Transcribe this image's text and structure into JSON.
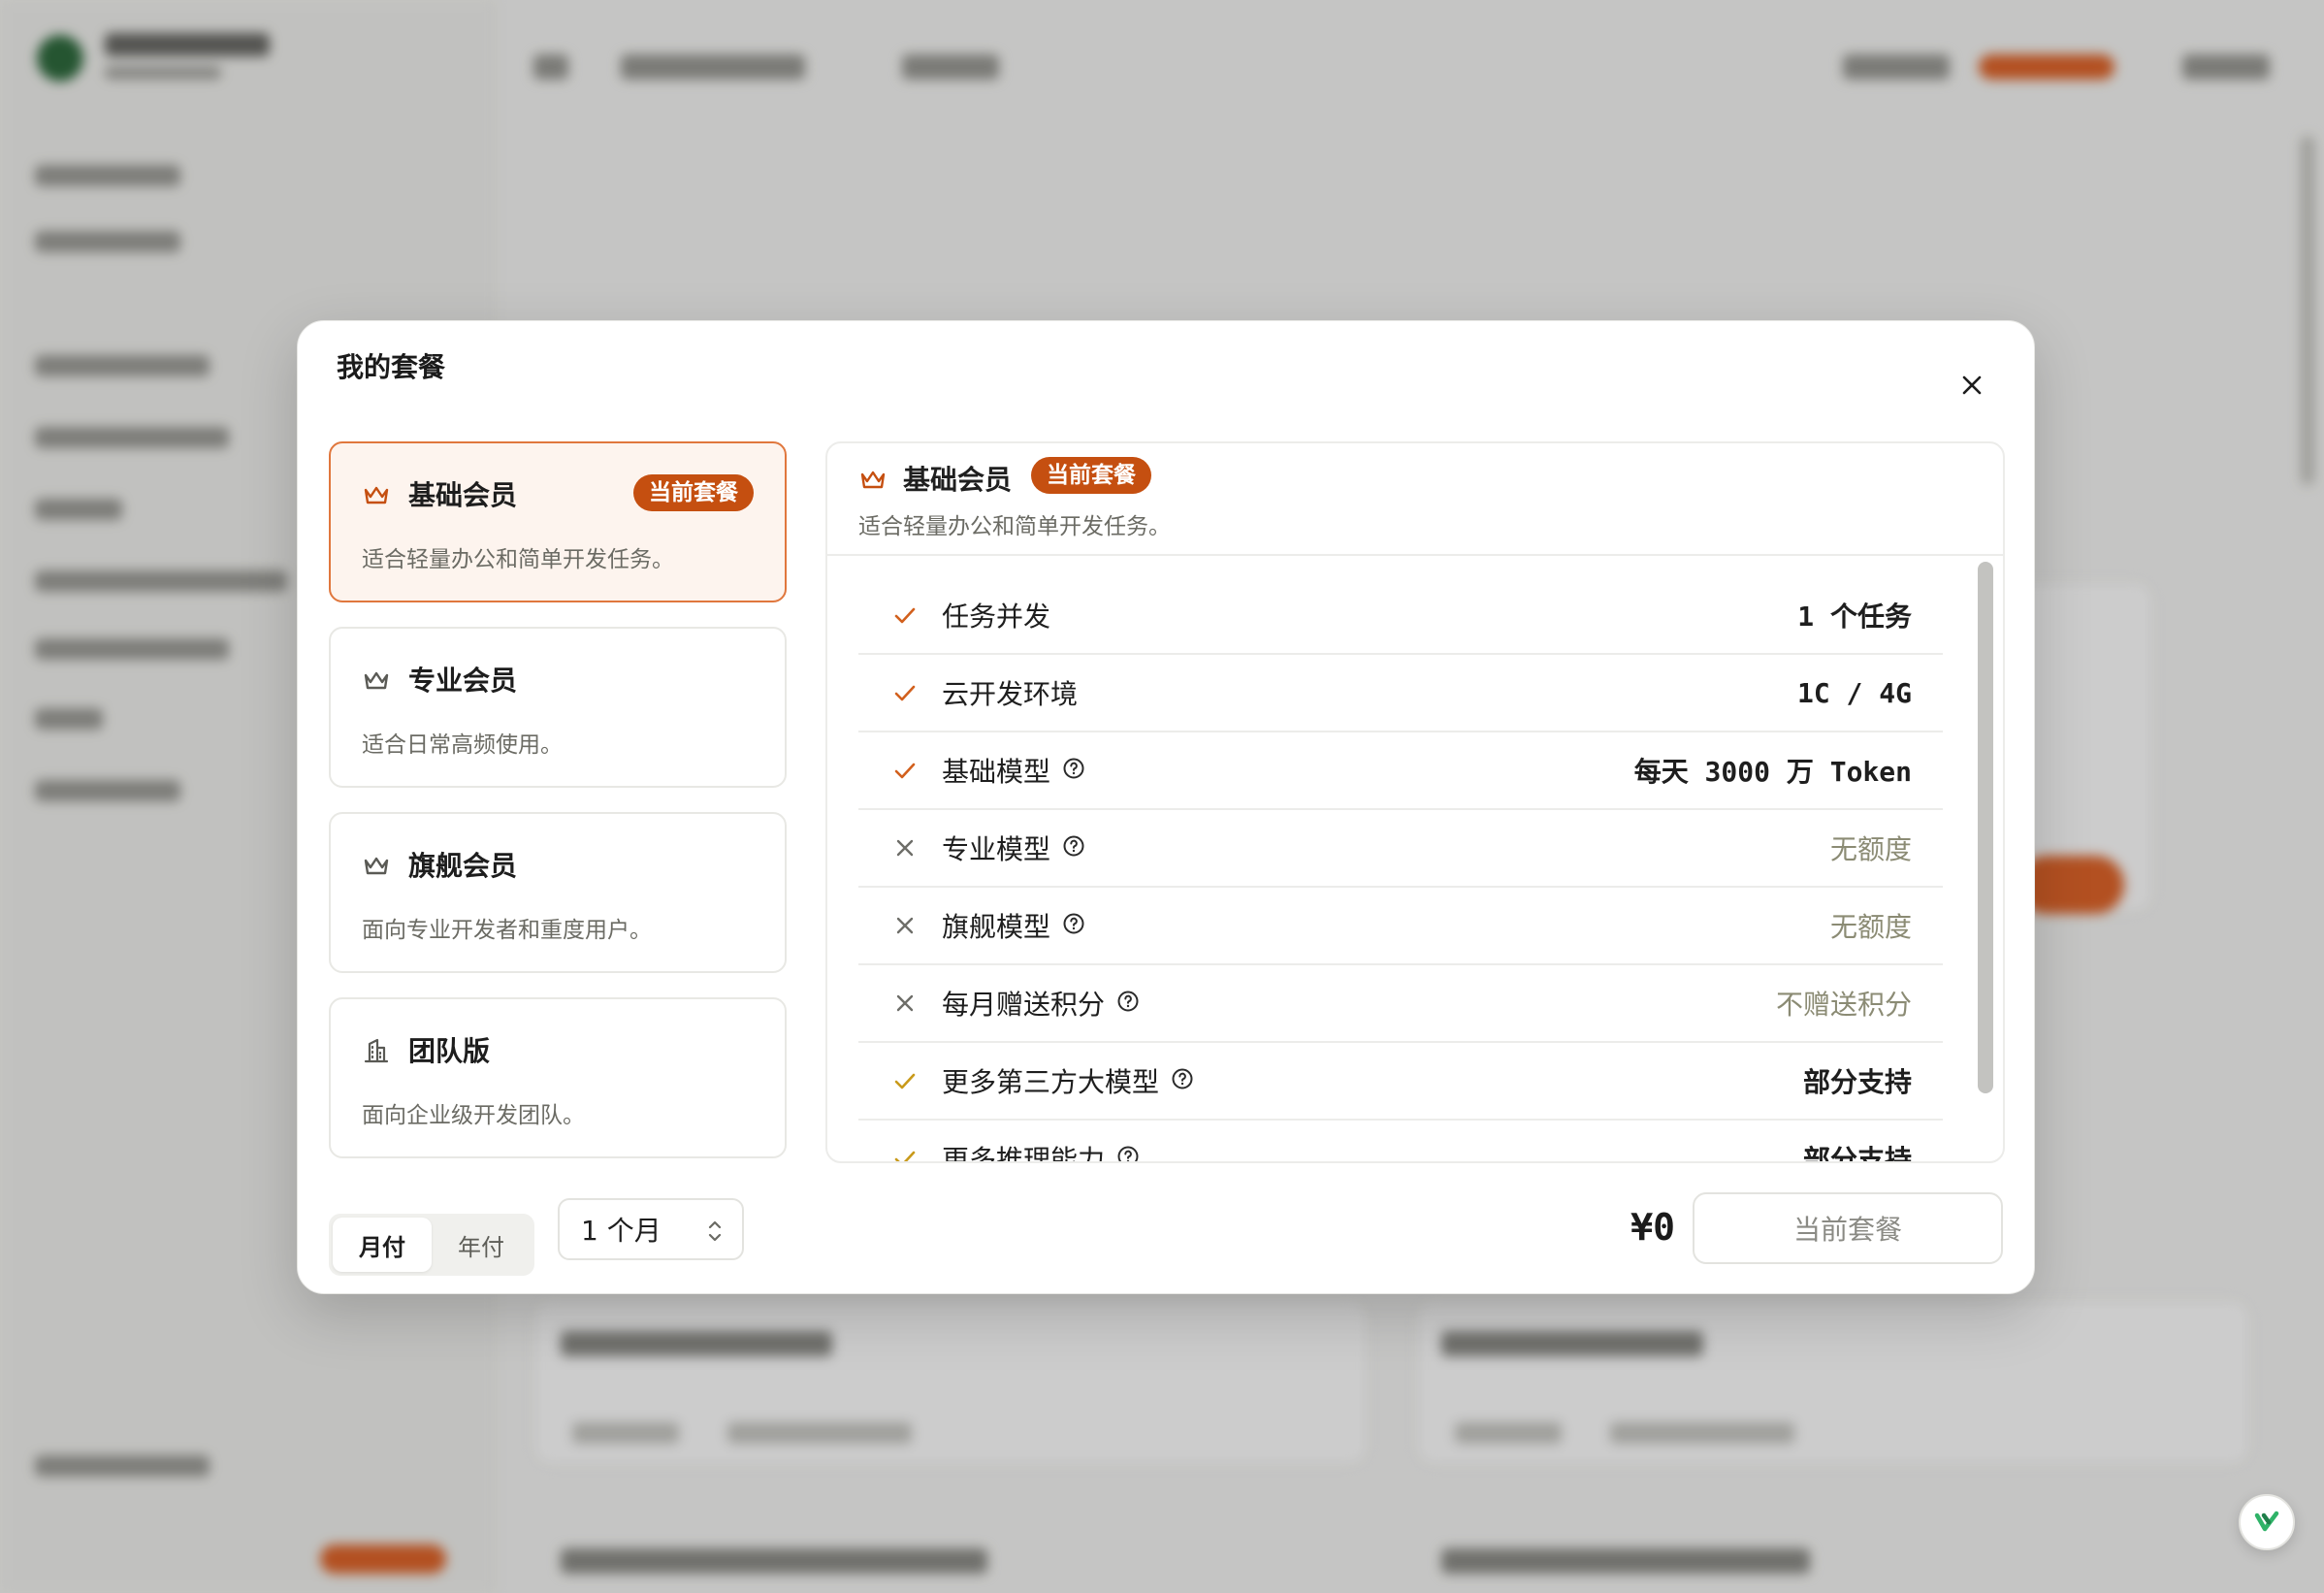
{
  "modal": {
    "title": "我的套餐",
    "close_icon": "close-icon"
  },
  "plans": [
    {
      "name": "基础会员",
      "desc": "适合轻量办公和简单开发任务。",
      "badge": "当前套餐",
      "icon": "crown-icon",
      "active": true
    },
    {
      "name": "专业会员",
      "desc": "适合日常高频使用。",
      "icon": "crown-icon",
      "active": false
    },
    {
      "name": "旗舰会员",
      "desc": "面向专业开发者和重度用户。",
      "icon": "crown-icon",
      "active": false
    },
    {
      "name": "团队版",
      "desc": "面向企业级开发团队。",
      "icon": "building-icon",
      "active": false
    }
  ],
  "detail": {
    "name": "基础会员",
    "badge": "当前套餐",
    "desc": "适合轻量办公和简单开发任务。",
    "features": [
      {
        "label": "任务并发",
        "value": "1 个任务",
        "included": true,
        "help": false
      },
      {
        "label": "云开发环境",
        "value": "1C / 4G",
        "included": true,
        "help": false
      },
      {
        "label": "基础模型",
        "value": "每天 3000 万 Token",
        "included": true,
        "help": true
      },
      {
        "label": "专业模型",
        "value": "无额度",
        "included": false,
        "help": true
      },
      {
        "label": "旗舰模型",
        "value": "无额度",
        "included": false,
        "help": true
      },
      {
        "label": "每月赠送积分",
        "value": "不赠送积分",
        "included": false,
        "help": true
      },
      {
        "label": "更多第三方大模型",
        "value": "部分支持",
        "included": "partial",
        "help": true
      },
      {
        "label": "更多推理能力",
        "value": "部分支持",
        "included": "partial",
        "help": true
      }
    ]
  },
  "footer": {
    "billing_monthly": "月付",
    "billing_yearly": "年付",
    "duration": "1 个月",
    "price": "¥0",
    "cta": "当前套餐"
  },
  "colors": {
    "accent": "#c54f10",
    "accent_border": "#e0773d",
    "check": "#d2601d",
    "check_partial": "#c99a1a",
    "cross": "#6d6d68",
    "muted_value": "#8b8b74"
  }
}
